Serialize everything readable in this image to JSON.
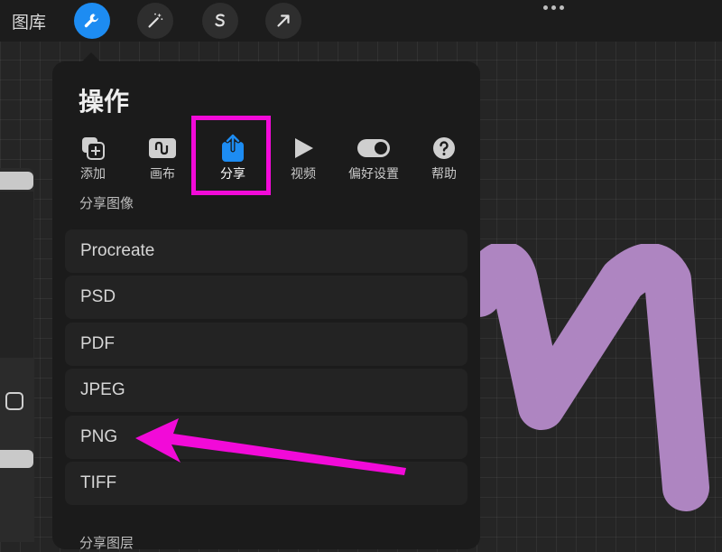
{
  "topbar": {
    "gallery_label": "图库",
    "tools": [
      {
        "icon": "wrench-icon",
        "active": true
      },
      {
        "icon": "magic-wand-icon",
        "active": false
      },
      {
        "icon": "selection-s-icon",
        "active": false
      },
      {
        "icon": "transform-arrow-icon",
        "active": false
      }
    ],
    "accent_color": "#1d8cf2"
  },
  "actions_panel": {
    "title": "操作",
    "tabs": [
      {
        "label": "添加",
        "icon": "add-layers-icon"
      },
      {
        "label": "画布",
        "icon": "canvas-wave-icon"
      },
      {
        "label": "分享",
        "icon": "share-icon",
        "active": true
      },
      {
        "label": "视频",
        "icon": "play-icon"
      },
      {
        "label": "偏好设置",
        "icon": "toggle-icon"
      },
      {
        "label": "帮助",
        "icon": "help-icon"
      }
    ],
    "share_image_section": "分享图像",
    "formats": [
      "Procreate",
      "PSD",
      "PDF",
      "JPEG",
      "PNG",
      "TIFF"
    ],
    "share_layers_section": "分享图层"
  },
  "annotations": {
    "highlight_color": "#f20ad8",
    "arrow_target": "PNG"
  },
  "canvas": {
    "stroke_color": "#b58ac9"
  }
}
